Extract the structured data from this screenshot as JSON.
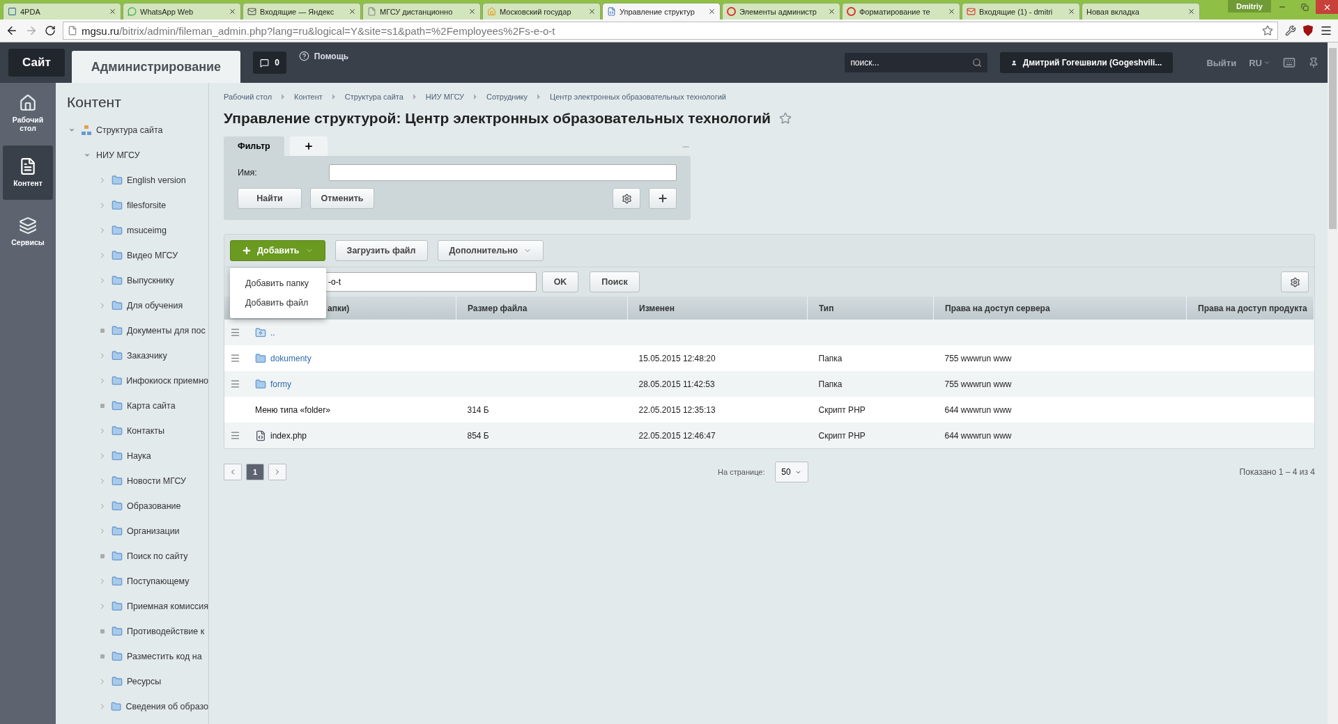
{
  "browser": {
    "tabs": [
      {
        "title": "4PDA",
        "selected": false
      },
      {
        "title": "WhatsApp Web",
        "selected": false
      },
      {
        "title": "Входящие — Яндекс",
        "selected": false
      },
      {
        "title": "МГСУ дистанционно",
        "selected": false
      },
      {
        "title": "Московский государ",
        "selected": false
      },
      {
        "title": "Управление структур",
        "selected": true
      },
      {
        "title": "Элементы администр",
        "selected": false
      },
      {
        "title": "Форматирование те",
        "selected": false
      },
      {
        "title": "Входящие (1) - dmitri",
        "selected": false
      },
      {
        "title": "Новая вкладка",
        "selected": false
      }
    ],
    "profile": "Dmitriy",
    "url_host": "mgsu.ru",
    "url_path": "/bitrix/admin/fileman_admin.php?lang=ru&logical=Y&site=s1&path=%2Femployees%2Fs-e-o-t"
  },
  "header": {
    "tabs": [
      {
        "label": "Сайт",
        "selected": false
      },
      {
        "label": "Администрирование",
        "selected": true
      }
    ],
    "notifications": "0",
    "help": "Помощь",
    "search_placeholder": "поиск...",
    "user": "Дмитрий Гогешвили (Gogeshvili...",
    "logout": "Выйти",
    "language": "RU"
  },
  "rail": [
    {
      "label": "Рабочий стол",
      "selected": false
    },
    {
      "label": "Контент",
      "selected": true
    },
    {
      "label": "Сервисы",
      "selected": false
    }
  ],
  "tree": {
    "title": "Контент",
    "nodes": [
      {
        "label": "Структура сайта",
        "kind": "root",
        "expanded": true,
        "children": [
          {
            "label": "НИУ МГСУ",
            "kind": "site",
            "expanded": true,
            "children": [
              {
                "label": "English version",
                "kind": "branch",
                "expanded": false
              },
              {
                "label": "filesforsite",
                "kind": "branch",
                "expanded": false
              },
              {
                "label": "msuceimg",
                "kind": "branch",
                "expanded": false
              },
              {
                "label": "Видео МГСУ",
                "kind": "branch",
                "expanded": false
              },
              {
                "label": "Выпускнику",
                "kind": "branch",
                "expanded": false
              },
              {
                "label": "Для обучения",
                "kind": "branch",
                "expanded": false
              },
              {
                "label": "Документы для пос",
                "kind": "leaf"
              },
              {
                "label": "Заказчику",
                "kind": "branch",
                "expanded": false
              },
              {
                "label": "Инфокиоск приемно",
                "kind": "branch",
                "expanded": false
              },
              {
                "label": "Карта сайта",
                "kind": "leaf"
              },
              {
                "label": "Контакты",
                "kind": "branch",
                "expanded": false
              },
              {
                "label": "Наука",
                "kind": "branch",
                "expanded": false
              },
              {
                "label": "Новости МГСУ",
                "kind": "branch",
                "expanded": false
              },
              {
                "label": "Образование",
                "kind": "branch",
                "expanded": false
              },
              {
                "label": "Организации",
                "kind": "branch",
                "expanded": false
              },
              {
                "label": "Поиск по сайту",
                "kind": "leaf"
              },
              {
                "label": "Поступающему",
                "kind": "branch",
                "expanded": false
              },
              {
                "label": "Приемная комиссия",
                "kind": "branch",
                "expanded": false
              },
              {
                "label": "Противодействие к",
                "kind": "leaf"
              },
              {
                "label": "Разместить код на",
                "kind": "leaf"
              },
              {
                "label": "Ресурсы",
                "kind": "branch",
                "expanded": false
              },
              {
                "label": "Сведения об образо",
                "kind": "branch",
                "expanded": false
              }
            ]
          }
        ]
      }
    ]
  },
  "breadcrumbs": [
    "Рабочий стол",
    "Контент",
    "Структура сайта",
    "НИУ МГСУ",
    "Сотруднику",
    "Центр электронных образовательных технологий"
  ],
  "title": "Управление структурой: Центр электронных образовательных технологий",
  "filter": {
    "tab": "Фильтр",
    "name_label": "Имя:",
    "find": "Найти",
    "cancel": "Отменить"
  },
  "toolbar": {
    "add": "Добавить",
    "upload": "Загрузить файл",
    "more": "Дополнительно",
    "add_menu": [
      "Добавить папку",
      "Добавить файл"
    ]
  },
  "path": {
    "value": "-o-t",
    "ok": "OK",
    "search": "Поиск"
  },
  "table": {
    "columns": [
      "апки)",
      "Размер файла",
      "Изменен",
      "Тип",
      "Права на доступ сервера",
      "Права на доступ продукта"
    ],
    "rows": [
      {
        "kind": "parent",
        "name": "..",
        "size": "",
        "changed": "",
        "type": "",
        "server": "",
        "product": ""
      },
      {
        "kind": "folder",
        "name": "dokumenty",
        "size": "",
        "changed": "15.05.2015 12:48:20",
        "type": "Папка",
        "server": "755 wwwrun www",
        "product": ""
      },
      {
        "kind": "folder",
        "name": "formy",
        "size": "",
        "changed": "28.05.2015 11:42:53",
        "type": "Папка",
        "server": "755 wwwrun www",
        "product": ""
      },
      {
        "kind": "menu",
        "name": "Меню типа «folder»",
        "size": "314 Б",
        "changed": "22.05.2015 12:35:13",
        "type": "Скрипт PHP",
        "server": "644 wwwrun www",
        "product": ""
      },
      {
        "kind": "file",
        "name": "index.php",
        "size": "854 Б",
        "changed": "22.05.2015 12:46:47",
        "type": "Скрипт PHP",
        "server": "644 wwwrun www",
        "product": ""
      }
    ]
  },
  "pager": {
    "pages": [
      {
        "label": "1",
        "selected": true
      }
    ],
    "per_page_label": "На странице:",
    "per_page": "50",
    "summary": "Показано 1 – 4 из 4"
  }
}
